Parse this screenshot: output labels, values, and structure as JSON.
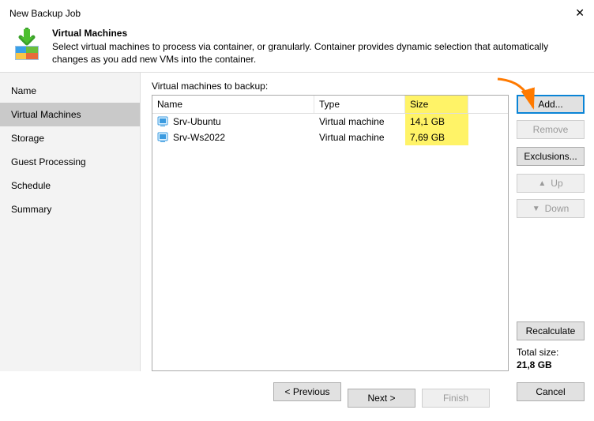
{
  "window": {
    "title": "New Backup Job"
  },
  "header": {
    "title": "Virtual Machines",
    "description": "Select virtual machines to process via container, or granularly. Container provides dynamic selection that automatically changes as you add new VMs into the container."
  },
  "sidebar": {
    "items": [
      {
        "label": "Name"
      },
      {
        "label": "Virtual Machines"
      },
      {
        "label": "Storage"
      },
      {
        "label": "Guest Processing"
      },
      {
        "label": "Schedule"
      },
      {
        "label": "Summary"
      }
    ],
    "activeIndex": 1
  },
  "main": {
    "label": "Virtual machines to backup:",
    "columns": {
      "name": "Name",
      "type": "Type",
      "size": "Size"
    },
    "rows": [
      {
        "name": "Srv-Ubuntu",
        "type": "Virtual machine",
        "size": "14,1 GB"
      },
      {
        "name": "Srv-Ws2022",
        "type": "Virtual machine",
        "size": "7,69 GB"
      }
    ]
  },
  "buttons": {
    "add": "Add...",
    "remove": "Remove",
    "exclusions": "Exclusions...",
    "up": "Up",
    "down": "Down",
    "recalculate": "Recalculate"
  },
  "totals": {
    "label": "Total size:",
    "value": "21,8 GB"
  },
  "footer": {
    "previous": "< Previous",
    "next": "Next >",
    "finish": "Finish",
    "cancel": "Cancel"
  }
}
